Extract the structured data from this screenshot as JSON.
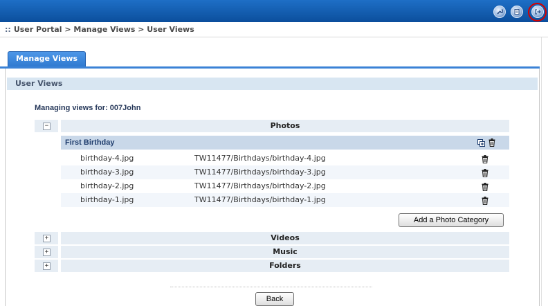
{
  "breadcrumb": {
    "grip": "::",
    "text": "User Portal > Manage Views > User Views"
  },
  "tabs": [
    {
      "label": "Manage Views"
    }
  ],
  "section": {
    "title": "User Views"
  },
  "managing_label": "Managing views for: 007John",
  "categories": [
    {
      "name": "Photos",
      "toggle": "−"
    },
    {
      "name": "Videos",
      "toggle": "+"
    },
    {
      "name": "Music",
      "toggle": "+"
    },
    {
      "name": "Folders",
      "toggle": "+"
    }
  ],
  "album": {
    "title": "First Birthday",
    "files": [
      {
        "name": "birthday-4.jpg",
        "path": "TW11477/Birthdays/birthday-4.jpg"
      },
      {
        "name": "birthday-3.jpg",
        "path": "TW11477/Birthdays/birthday-3.jpg"
      },
      {
        "name": "birthday-2.jpg",
        "path": "TW11477/Birthdays/birthday-2.jpg"
      },
      {
        "name": "birthday-1.jpg",
        "path": "TW11477/Birthdays/birthday-1.jpg"
      }
    ]
  },
  "buttons": {
    "add_category": "Add a Photo Category",
    "back": "Back"
  },
  "colors": {
    "header_blue": "#0b4e9c",
    "highlight_red": "#d40000",
    "album_bg": "#c9d8e9"
  },
  "icons": {
    "toolbar": [
      "wrench-icon",
      "notes-icon",
      "logout-icon"
    ],
    "delete": "trash-icon",
    "add": "add-item-icon"
  }
}
